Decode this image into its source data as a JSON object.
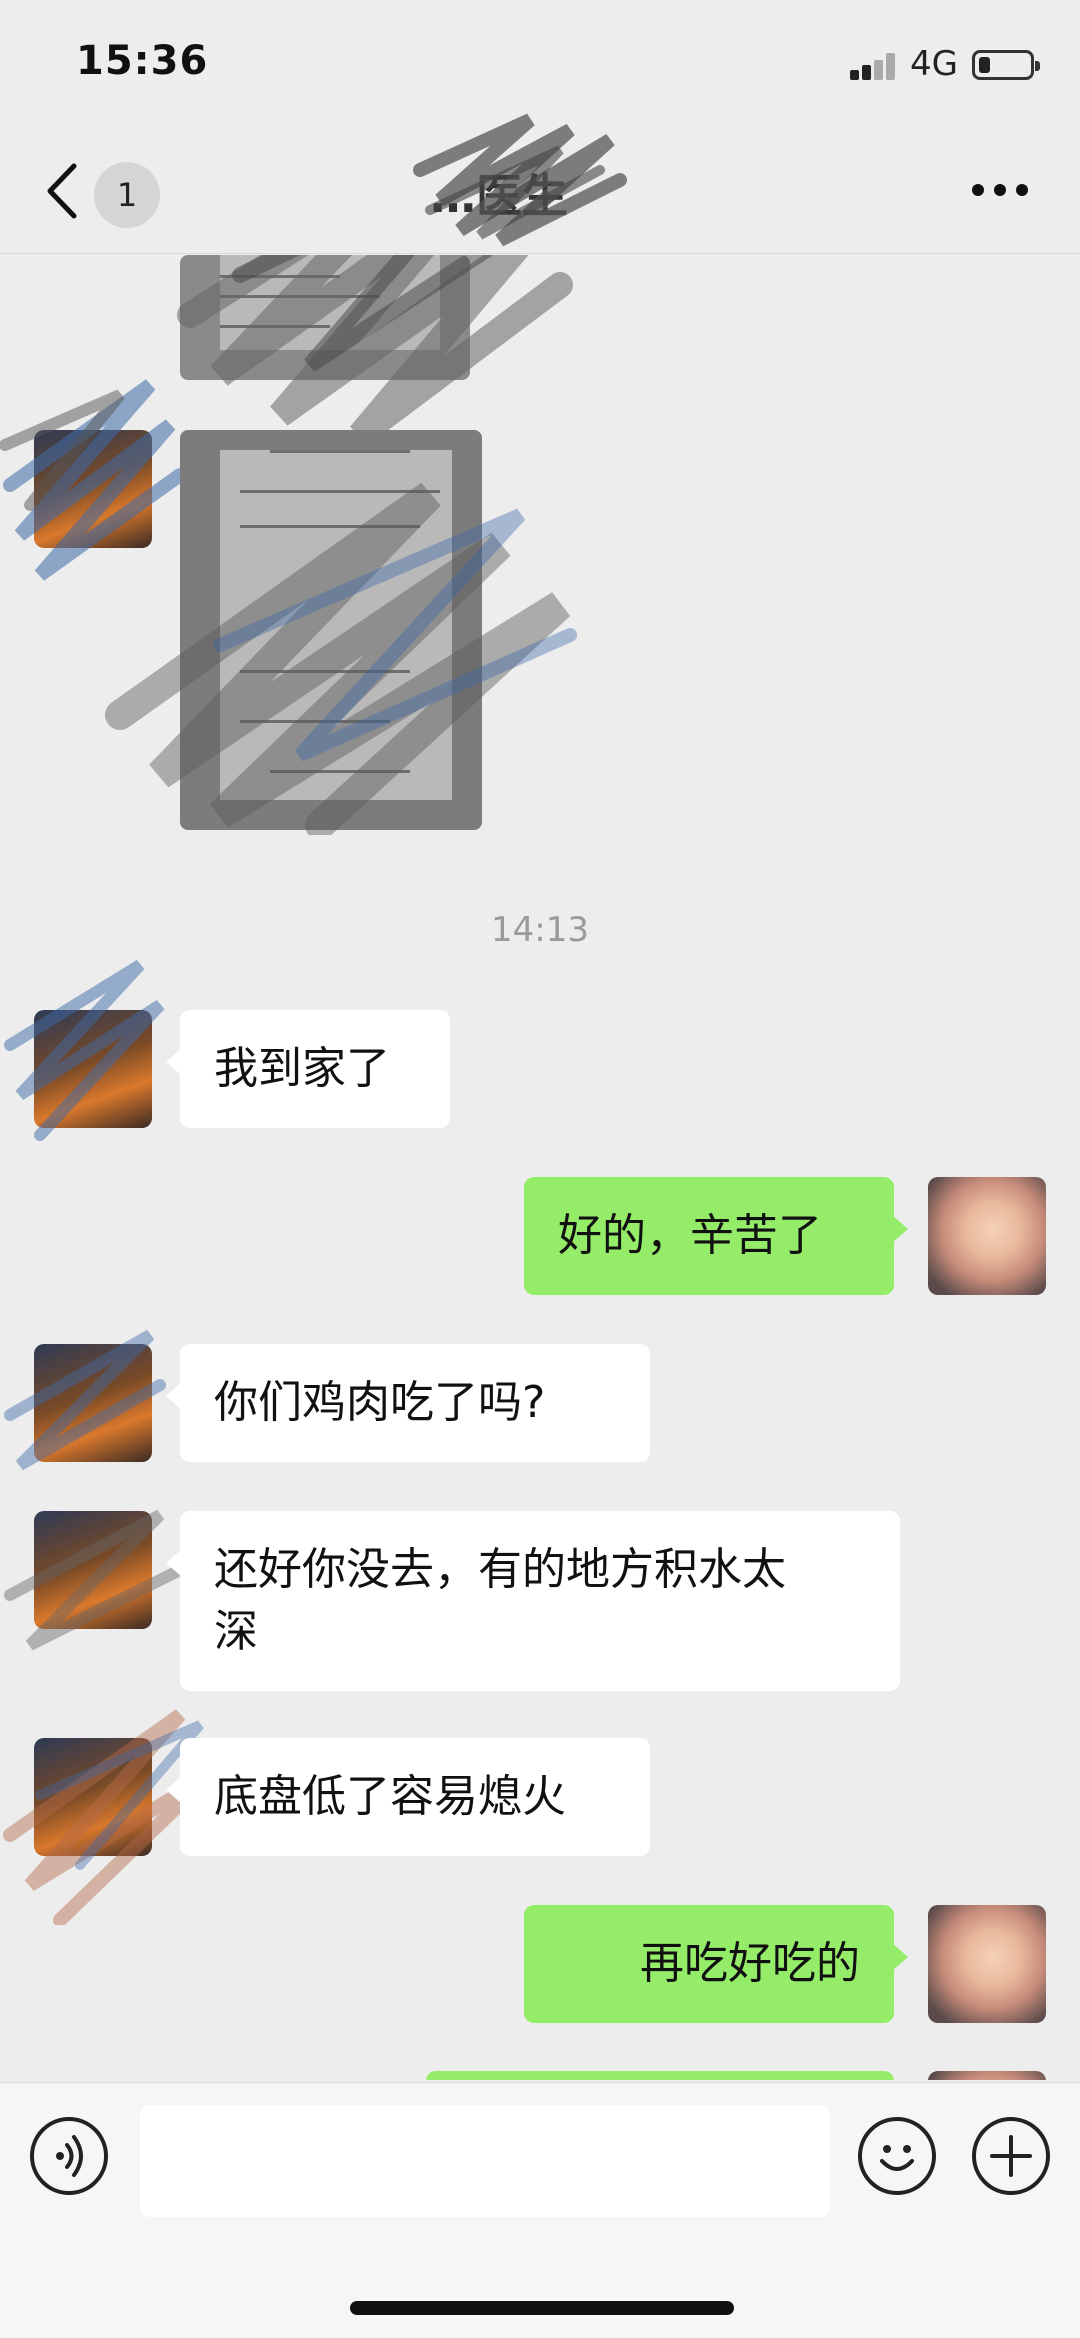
{
  "status_bar": {
    "time": "15:36",
    "network": "4G",
    "signal_icon": "cellular-signal-icon",
    "battery_icon": "battery-icon",
    "battery_level": 0.2
  },
  "nav": {
    "back_icon": "chevron-left-icon",
    "unread_count": "1",
    "title": "…医生",
    "more_icon": "more-dots-icon"
  },
  "messages": [
    {
      "type": "image",
      "side": "left",
      "content": "photo of a document (scribbled over)"
    },
    {
      "type": "image",
      "side": "left",
      "content": "photo of a form (scribbled over)"
    },
    {
      "type": "time",
      "text": "14:13"
    },
    {
      "type": "text",
      "side": "left",
      "text": "我到家了"
    },
    {
      "type": "text",
      "side": "right",
      "text": "好的，辛苦了"
    },
    {
      "type": "text",
      "side": "left",
      "text": "你们鸡肉吃了吗?"
    },
    {
      "type": "text",
      "side": "left",
      "line1": "还好你没去，有的地方积水太",
      "line2": "深"
    },
    {
      "type": "text",
      "side": "left",
      "text": "底盘低了容易熄火"
    },
    {
      "type": "text",
      "side": "right",
      "text": "再吃好吃的"
    }
  ],
  "input_bar": {
    "voice_icon": "voice-icon",
    "input_value": "",
    "emoji_icon": "emoji-icon",
    "plus_icon": "plus-icon"
  }
}
